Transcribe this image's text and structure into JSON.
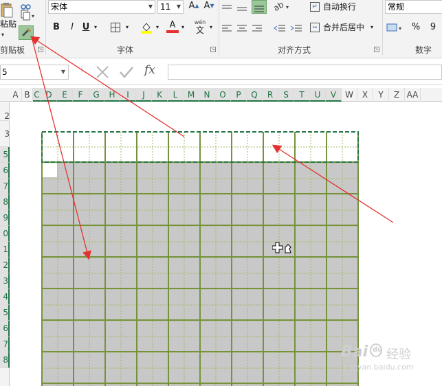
{
  "ribbon": {
    "clipboard": {
      "paste_label": "粘贴",
      "group_label": "剪贴板"
    },
    "font": {
      "font_name": "宋体",
      "font_size": "11",
      "grow_label": "A",
      "shrink_label": "A",
      "bold": "B",
      "italic": "I",
      "underline": "U",
      "wen_label": "wén",
      "wen_char": "文",
      "group_label": "字体"
    },
    "alignment": {
      "wrap_text": "自动换行",
      "merge_center": "合并后居中",
      "group_label": "对齐方式"
    },
    "number": {
      "format": "常规",
      "percent": "%",
      "comma": "9",
      "group_label": "数字"
    }
  },
  "formula_bar": {
    "name_box": "5",
    "fx_label": "fx"
  },
  "sheet": {
    "columns": [
      "A",
      "B",
      "C",
      "D",
      "E",
      "F",
      "G",
      "H",
      "I",
      "J",
      "K",
      "L",
      "M",
      "N",
      "O",
      "P",
      "Q",
      "R",
      "S",
      "T",
      "U",
      "V",
      "W",
      "X",
      "Y",
      "Z",
      "AA"
    ],
    "selected_columns": [
      "C",
      "D",
      "E",
      "F",
      "G",
      "H",
      "I",
      "J",
      "K",
      "L",
      "M",
      "N",
      "O",
      "P",
      "Q",
      "R",
      "S",
      "T",
      "U",
      "V"
    ],
    "rows": [
      "2",
      "3",
      "5",
      "6",
      "7",
      "8",
      "9",
      "0",
      "1",
      "2",
      "3",
      "4",
      "5",
      "6",
      "7",
      "8"
    ],
    "selected_rows": [
      "5",
      "6",
      "7",
      "8",
      "9",
      "0",
      "1",
      "2",
      "3",
      "4",
      "5",
      "6",
      "7",
      "8"
    ]
  },
  "watermark": {
    "logo": "Bai",
    "paw": "du",
    "brand": "经验",
    "url": "jingyan.baidu.com"
  },
  "colors": {
    "accent_green": "#217346",
    "grid_green": "#76923c",
    "grid_dotted": "#9bbb59",
    "selection_fill": "#c8c8c8",
    "arrow_red": "#e53030"
  }
}
